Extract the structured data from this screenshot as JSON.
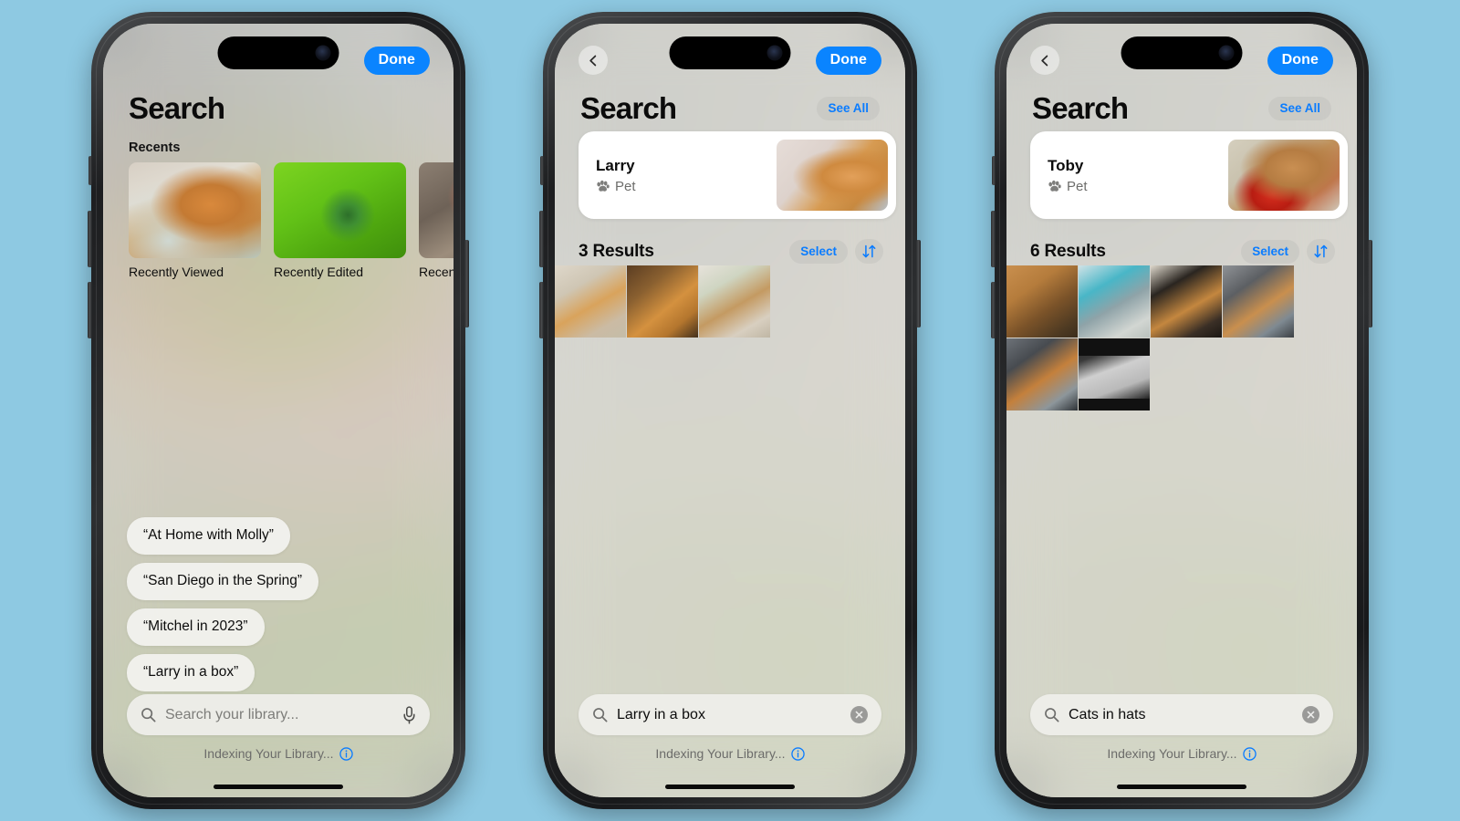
{
  "background_color": "#8ec9e2",
  "accent_color": "#0a84ff",
  "link_color": "#0a7cff",
  "phones": [
    {
      "id": "phone-search-recents",
      "has_back_button": false,
      "done_label": "Done",
      "title": "Search",
      "see_all_label": "",
      "section_label": "Recents",
      "recents": [
        {
          "caption": "Recently Viewed",
          "art": "art-cat-bed",
          "name": "recently-viewed"
        },
        {
          "caption": "Recently Edited",
          "art": "art-bug-leaf",
          "name": "recently-edited"
        },
        {
          "caption": "Recently Shared",
          "art": "art-mushroom",
          "name": "recently-shared"
        }
      ],
      "suggestions": [
        "“At Home with Molly”",
        "“San Diego in the Spring”",
        "“Mitchel in 2023”",
        "“Larry in a box”"
      ],
      "search": {
        "value": "",
        "placeholder": "Search your library...",
        "has_mic": true,
        "has_clear": false
      },
      "status": {
        "text": "Indexing Your Library...",
        "icon": "info-icon"
      }
    },
    {
      "id": "phone-results-larry",
      "has_back_button": true,
      "done_label": "Done",
      "title": "Search",
      "see_all_label": "See All",
      "pet_cards": [
        {
          "name": "Larry",
          "kind": "Pet",
          "art": "art-larry"
        }
      ],
      "results_count": "3 Results",
      "select_label": "Select",
      "sort_icon": "sort-arrows-icon",
      "results": [
        {
          "art": "a1",
          "name": "result-photo"
        },
        {
          "art": "a2",
          "name": "result-photo"
        },
        {
          "art": "a3",
          "name": "result-photo"
        }
      ],
      "search": {
        "value": "Larry in a box",
        "placeholder": "Search your library...",
        "has_mic": false,
        "has_clear": true
      },
      "status": {
        "text": "Indexing Your Library...",
        "icon": "info-icon"
      }
    },
    {
      "id": "phone-results-cats-in-hats",
      "has_back_button": true,
      "done_label": "Done",
      "title": "Search",
      "see_all_label": "See All",
      "pet_cards": [
        {
          "name": "Toby",
          "kind": "Pet",
          "art": "art-toby"
        },
        {
          "name": "",
          "kind": "",
          "art": "art-larry"
        }
      ],
      "results_count": "6 Results",
      "select_label": "Select",
      "sort_icon": "sort-arrows-icon",
      "results": [
        {
          "art": "a4",
          "name": "result-photo"
        },
        {
          "art": "a5",
          "name": "result-photo"
        },
        {
          "art": "a6",
          "name": "result-photo"
        },
        {
          "art": "a7",
          "name": "result-photo"
        },
        {
          "art": "a8",
          "name": "result-photo"
        },
        {
          "art": "a9",
          "name": "result-photo"
        }
      ],
      "search": {
        "value": "Cats in hats",
        "placeholder": "Search your library...",
        "has_mic": false,
        "has_clear": true
      },
      "status": {
        "text": "Indexing Your Library...",
        "icon": "info-icon"
      }
    }
  ]
}
